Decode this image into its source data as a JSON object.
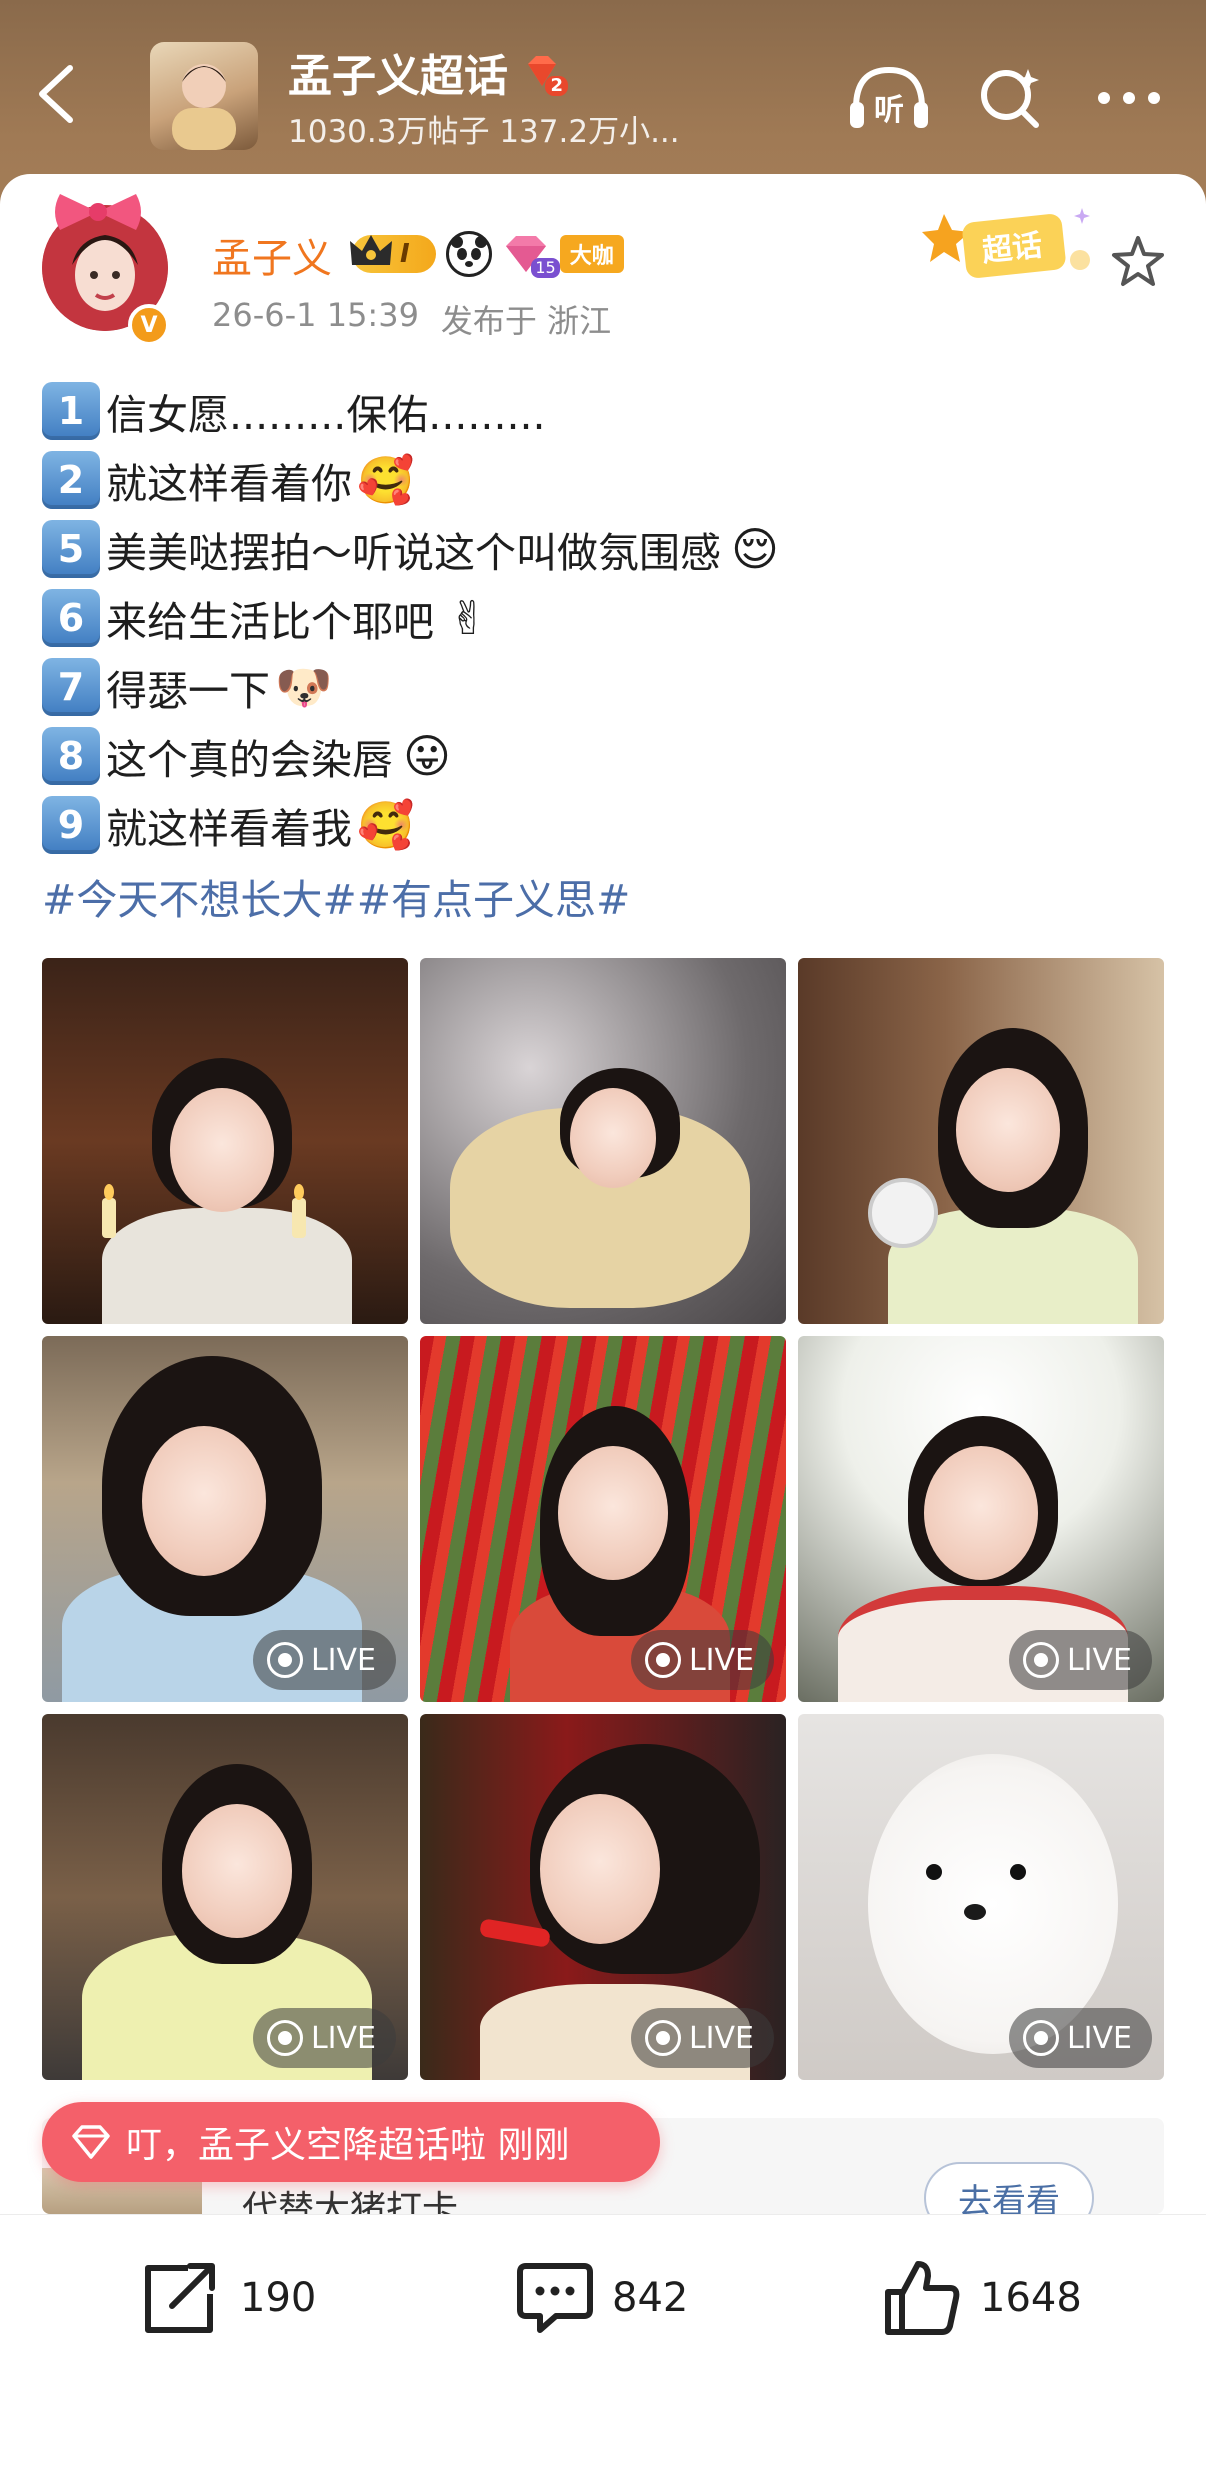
{
  "header": {
    "title": "孟子义超话",
    "level_badge": "2",
    "subtitle": "1030.3万帖子 137.2万小...",
    "listen_label": "听",
    "colors": {
      "background": "#a07a55",
      "text": "#ffffff"
    }
  },
  "post": {
    "author": {
      "name": "孟子义",
      "level_label": "I",
      "gem_level": "15",
      "daka_label": "大咖",
      "verified_label": "V",
      "name_color": "#f0761f"
    },
    "timestamp": "26-6-1 15:39",
    "location": "发布于 浙江",
    "supertopic_tag": "超话",
    "lines": [
      {
        "num": "1",
        "text": "信女愿.........保佑.........",
        "emoji": ""
      },
      {
        "num": "2",
        "text": "就这样看着你",
        "emoji": "🥰"
      },
      {
        "num": "5",
        "text": "美美哒摆拍～听说这个叫做氛围感",
        "emoji": "😌"
      },
      {
        "num": "6",
        "text": "来给生活比个耶吧",
        "emoji": "✌"
      },
      {
        "num": "7",
        "text": "得瑟一下",
        "emoji": "🐶"
      },
      {
        "num": "8",
        "text": "这个真的会染唇",
        "emoji": "😛"
      },
      {
        "num": "9",
        "text": "就这样看着我",
        "emoji": "🥰"
      }
    ],
    "hashtags": "#今天不想长大##有点子义思#",
    "images": [
      {
        "name": "photo-praying-candles",
        "live": false,
        "live_label": ""
      },
      {
        "name": "photo-flower-petals",
        "live": false,
        "live_label": ""
      },
      {
        "name": "photo-green-hanfu-fan",
        "live": false,
        "live_label": ""
      },
      {
        "name": "photo-blue-hanfu-set",
        "live": true,
        "live_label": "LIVE"
      },
      {
        "name": "photo-red-ribbons",
        "live": true,
        "live_label": "LIVE"
      },
      {
        "name": "photo-blossoms-peace",
        "live": true,
        "live_label": "LIVE"
      },
      {
        "name": "photo-yellow-hanfu",
        "live": true,
        "live_label": "LIVE"
      },
      {
        "name": "photo-red-lips-set",
        "live": true,
        "live_label": "LIVE"
      },
      {
        "name": "photo-white-pomeranian",
        "live": true,
        "live_label": "LIVE"
      }
    ]
  },
  "toast": {
    "text": "叮，孟子义空降超话啦 刚刚",
    "color": "#f4606a"
  },
  "promo": {
    "text": "代替大猪打卡",
    "button": "去看看"
  },
  "actions": {
    "repost_count": "190",
    "comment_count": "842",
    "like_count": "1648"
  }
}
